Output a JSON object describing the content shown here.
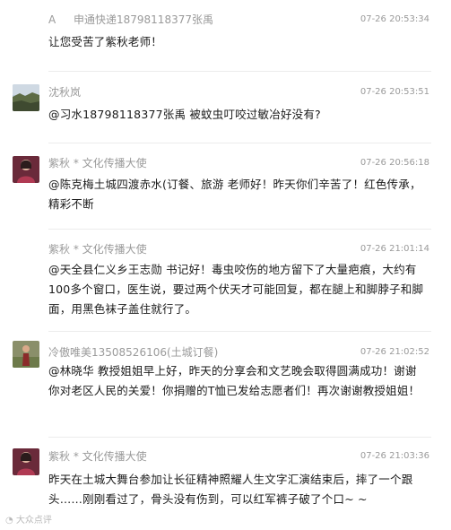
{
  "comments": [
    {
      "avatar_letter": "A",
      "name": "申通快递18798118377张禹",
      "time": "07-26 20:53:34",
      "text": "让您受苦了紫秋老师！"
    },
    {
      "name": "沈秋岚",
      "time": "07-26 20:53:51",
      "text": "@习水18798118377张禹 被蚊虫叮咬过敏冶好没有?"
    },
    {
      "name": "紫秋 * 文化传播大使",
      "time": "07-26 20:56:18",
      "text": "@陈克梅土城四渡赤水(订餐、旅游 老师好！昨天你们辛苦了！红色传承，精彩不断"
    },
    {
      "name": "紫秋 * 文化传播大使",
      "time": "07-26 21:01:14",
      "text": "@天全县仁义乡王志勋 书记好！毒虫咬伤的地方留下了大量疤痕，大约有100多个窗口，医生说，要过两个伏天才可能回复，都在腿上和脚脖子和脚面，用黑色袜子盖住就行了。"
    },
    {
      "name": "冷傲唯美13508526106(土城订餐)",
      "time": "07-26 21:02:52",
      "text": "@林晓华 教授姐姐早上好，昨天的分享会和文艺晚会取得圆满成功！谢谢你对老区人民的关爱！你捐赠的T恤已发给志愿者们！再次谢谢教授姐姐！"
    },
    {
      "name": "紫秋 * 文化传播大使",
      "time": "07-26 21:03:36",
      "text": "昨天在土城大舞台参加让长征精神照耀人生文字汇演结束后，摔了一个跟头……刚刚看过了，骨头没有伤到，可以红军裤子破了个口~ ~"
    }
  ],
  "watermark": "大众点评"
}
